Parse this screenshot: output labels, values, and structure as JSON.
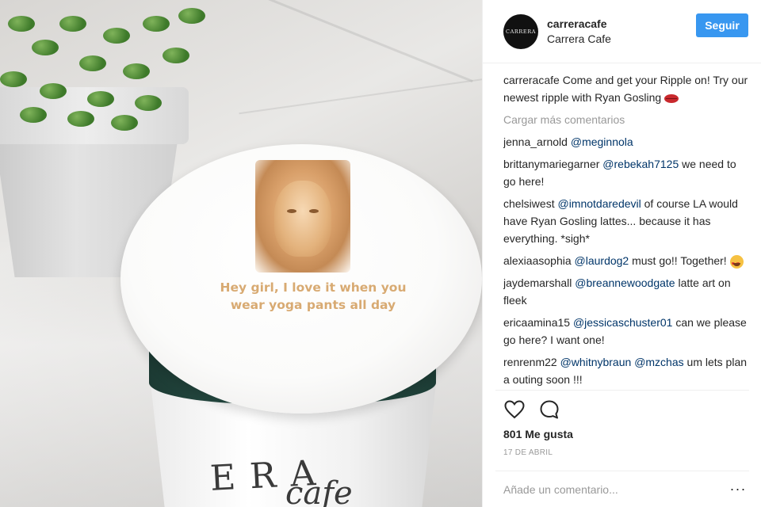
{
  "post": {
    "image": {
      "latte_text_line1": "Hey girl, I love it when you",
      "latte_text_line2": "wear yoga pants all day",
      "cup_print_top": "ERA",
      "cup_print_bottom": "cafe"
    },
    "header": {
      "avatar_text": "CARRERA",
      "username": "carreracafe",
      "full_name": "Carrera Cafe",
      "follow_label": "Seguir"
    },
    "caption": {
      "username": "carreracafe",
      "text": "Come and get your Ripple on! Try our newest ripple with Ryan Gosling",
      "emoji": "kiss-mark"
    },
    "load_more_label": "Cargar más comentarios",
    "comments": [
      {
        "username": "jenna_arnold",
        "mention": "@meginnola",
        "text": ""
      },
      {
        "username": "brittanymariegarner",
        "mention": "@rebekah7125",
        "text": "we need to go here!"
      },
      {
        "username": "chelsiwest",
        "mention": "@imnotdaredevil",
        "text": "of course LA would have Ryan Gosling lattes... because it has everything. *sigh*"
      },
      {
        "username": "alexiaasophia",
        "mention": "@laurdog2",
        "text": "must go!! Together!",
        "emoji": "heart-eyes"
      },
      {
        "username": "jaydemarshall",
        "mention": "@breannewoodgate",
        "text": "latte art on fleek"
      },
      {
        "username": "ericaamina15",
        "mention": "@jessicaschuster01",
        "text": "can we please go here? I want one!"
      },
      {
        "username": "renrenm22",
        "mention": "@whitnybraun",
        "mention2": "@mzchas",
        "text": "um lets plan a outing soon !!!"
      }
    ],
    "actions": {
      "like_icon": "heart-outline-icon",
      "comment_icon": "speech-bubble-icon"
    },
    "likes_label": "801 Me gusta",
    "date_label": "17 DE ABRIL",
    "comment_input": {
      "placeholder": "Añade un comentario...",
      "value": ""
    },
    "more_label": "···",
    "colors": {
      "accent": "#3897f0",
      "mention": "#003569",
      "muted": "#999999"
    }
  }
}
